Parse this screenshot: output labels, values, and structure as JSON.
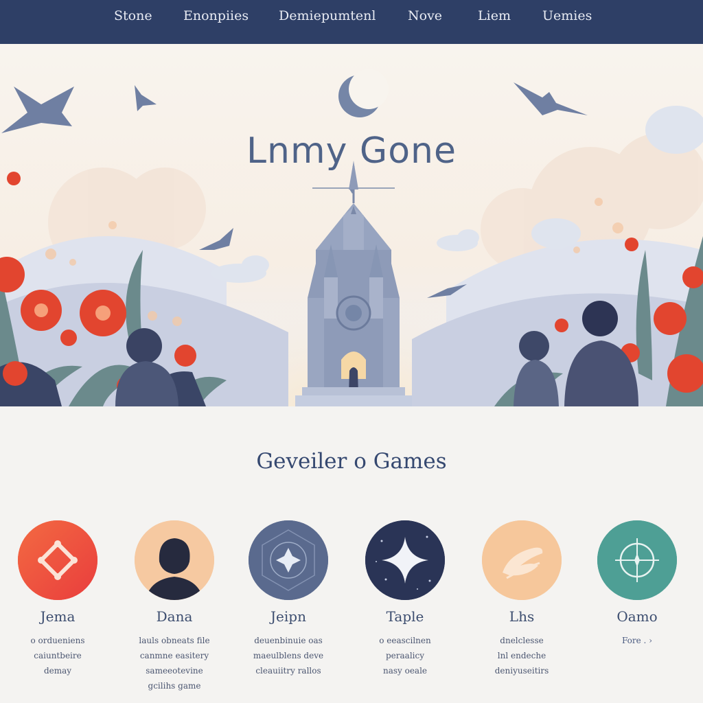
{
  "nav": {
    "items": [
      "Stone",
      "Enonpiies",
      "Demiepumtenl",
      "Nove",
      "Liem",
      "Uemies"
    ]
  },
  "hero": {
    "title": "Lnmy Gone"
  },
  "section": {
    "title": "Geveiler o Games"
  },
  "cards": [
    {
      "name": "Jema",
      "desc": [
        "o ordueniens",
        "caiuntbeire",
        "demay"
      ],
      "color": "#ef5a3c"
    },
    {
      "name": "Dana",
      "desc": [
        "lauls obneats file",
        "canmne easitery",
        "sameeotevine",
        "gcilihs game"
      ],
      "color": "#f6c9a1"
    },
    {
      "name": "Jeipn",
      "desc": [
        "deuenbinuie oas",
        "maeulblens deve",
        "cleauiitry rallos"
      ],
      "color": "#5a6a8e"
    },
    {
      "name": "Taple",
      "desc": [
        "o eeascilnen",
        "peraalicy",
        "nasy oeale"
      ],
      "color": "#2a3456"
    },
    {
      "name": "Lhs",
      "desc": [
        "dnelclesse",
        "lnl endeche",
        "deniyuseitirs"
      ],
      "color": "#f6c79b"
    },
    {
      "name": "Oamo",
      "desc": [
        "Fore ."
      ],
      "color": "#4e9f95"
    }
  ],
  "colors": {
    "nav_bg": "#2e3f66",
    "hero_bg": "#f6f1ea",
    "page_bg": "#f4f3f1",
    "accent_red": "#e2452f",
    "accent_blue": "#5a6a8e"
  }
}
